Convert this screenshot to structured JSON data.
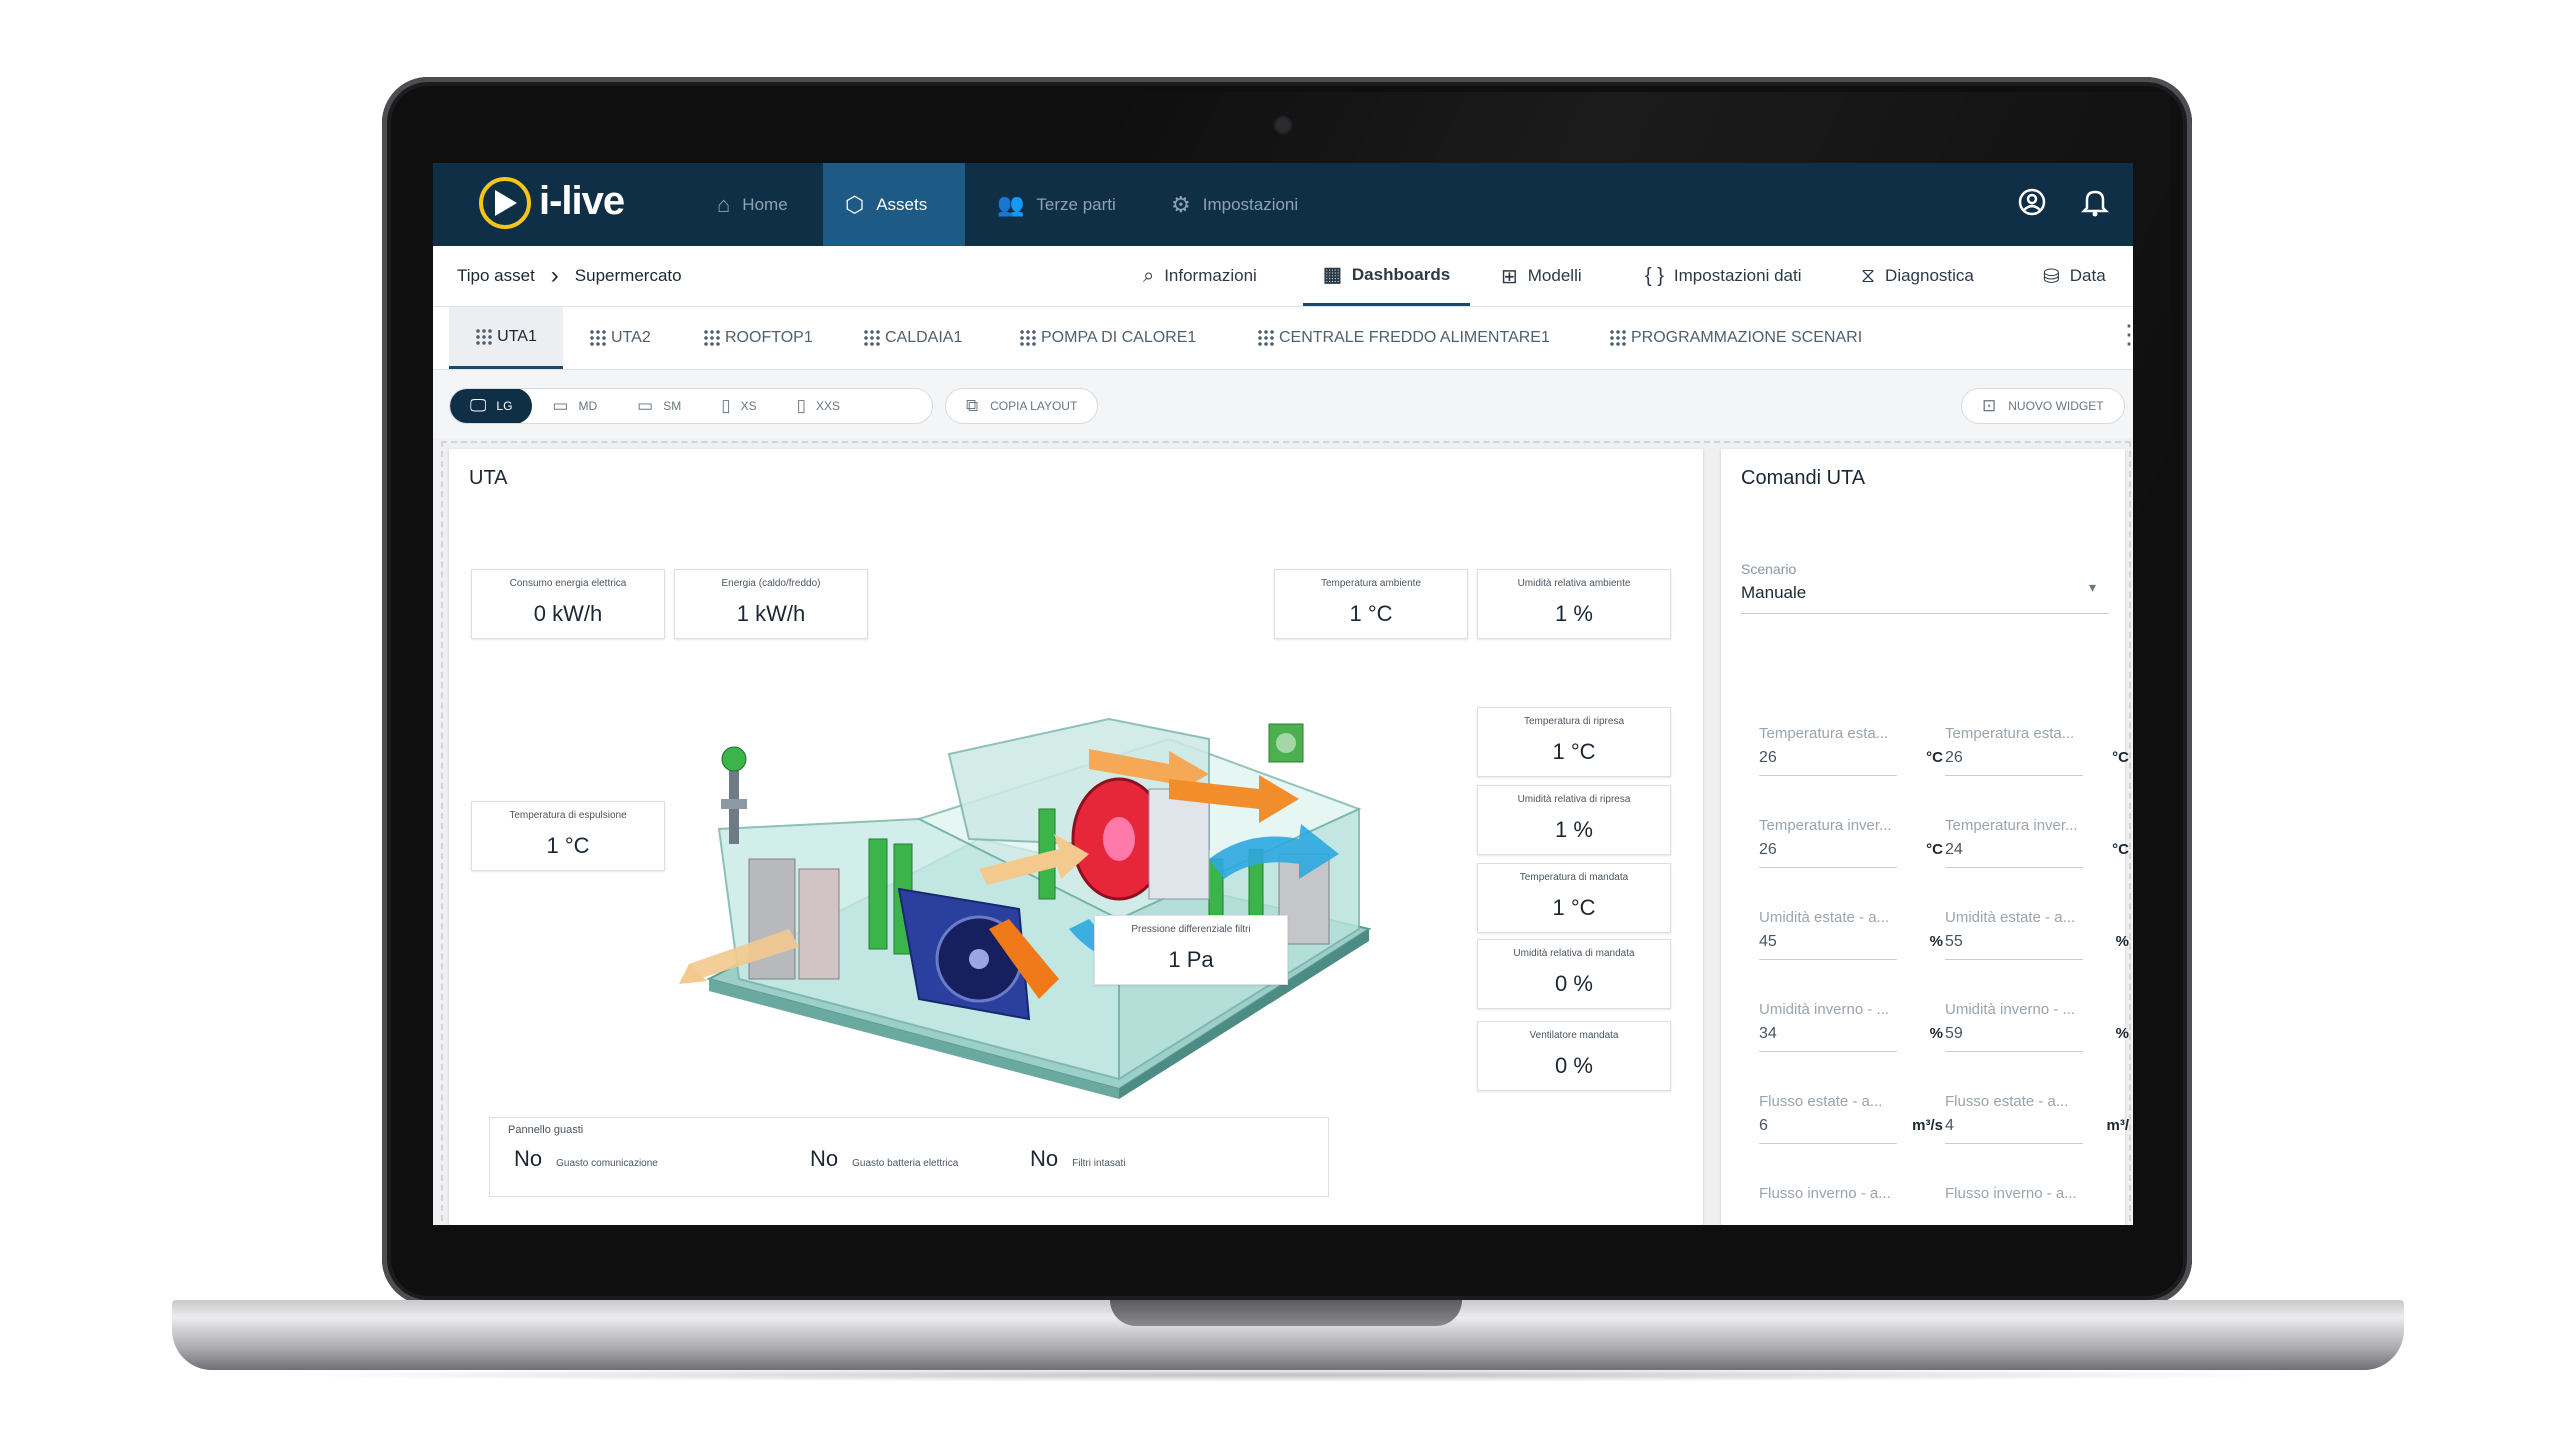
{
  "app": {
    "logo_text": "i-live"
  },
  "nav": {
    "items": [
      {
        "label": "Home",
        "icon": "home-icon"
      },
      {
        "label": "Assets",
        "icon": "cube-icon",
        "active": true
      },
      {
        "label": "Terze parti",
        "icon": "people-icon"
      },
      {
        "label": "Impostazioni",
        "icon": "gear-icon"
      }
    ]
  },
  "breadcrumb": {
    "root": "Tipo asset",
    "current": "Supermercato"
  },
  "subtabs": [
    {
      "label": "Informazioni",
      "icon": "info-search-icon"
    },
    {
      "label": "Dashboards",
      "icon": "dashboard-icon",
      "active": true
    },
    {
      "label": "Modelli",
      "icon": "models-icon"
    },
    {
      "label": "Impostazioni dati",
      "icon": "braces-icon"
    },
    {
      "label": "Diagnostica",
      "icon": "diagnostics-icon"
    },
    {
      "label": "Data",
      "icon": "database-icon"
    }
  ],
  "asset_tabs": [
    "UTA1",
    "UTA2",
    "ROOFTOP1",
    "CALDAIA1",
    "POMPA DI CALORE1",
    "CENTRALE FREDDO ALIMENTARE1",
    "PROGRAMMAZIONE SCENARI"
  ],
  "toolbar": {
    "sizes": [
      "LG",
      "MD",
      "SM",
      "XS",
      "XXS"
    ],
    "copy_layout": "COPIA LAYOUT",
    "new_widget": "NUOVO WIDGET"
  },
  "uta": {
    "title": "UTA",
    "readouts": {
      "consumo": {
        "label": "Consumo energia elettrica",
        "value": "0 kW/h"
      },
      "energia": {
        "label": "Energia (caldo/freddo)",
        "value": "1 kW/h"
      },
      "temp_amb": {
        "label": "Temperatura ambiente",
        "value": "1 °C"
      },
      "umid_amb": {
        "label": "Umidità relativa ambiente",
        "value": "1 %"
      },
      "temp_ripresa": {
        "label": "Temperatura di ripresa",
        "value": "1 °C"
      },
      "umid_ripresa": {
        "label": "Umidità relativa di ripresa",
        "value": "1 %"
      },
      "temp_mandata": {
        "label": "Temperatura di mandata",
        "value": "1 °C"
      },
      "umid_mandata": {
        "label": "Umidità relativa di mandata",
        "value": "0 %"
      },
      "ventilatore": {
        "label": "Ventilatore mandata",
        "value": "0 %"
      },
      "temp_espulsione": {
        "label": "Temperatura di espulsione",
        "value": "1 °C"
      },
      "pressione": {
        "label": "Pressione differenziale filtri",
        "value": "1 Pa"
      }
    },
    "faults": {
      "title": "Pannello guasti",
      "items": [
        {
          "value": "No",
          "label": "Guasto comunicazione"
        },
        {
          "value": "No",
          "label": "Guasto batteria elettrica"
        },
        {
          "value": "No",
          "label": "Filtri intasati"
        }
      ]
    }
  },
  "comandi": {
    "title": "Comandi UTA",
    "scenario_label": "Scenario",
    "scenario_value": "Manuale",
    "fields": [
      {
        "label": "Temperatura esta...",
        "value": "26",
        "unit": "°C"
      },
      {
        "label": "Temperatura esta...",
        "value": "26",
        "unit": "°C"
      },
      {
        "label": "Temperatura inver...",
        "value": "26",
        "unit": "°C"
      },
      {
        "label": "Temperatura inver...",
        "value": "24",
        "unit": "°C"
      },
      {
        "label": "Umidità estate - a...",
        "value": "45",
        "unit": "%"
      },
      {
        "label": "Umidità estate - a...",
        "value": "55",
        "unit": "%"
      },
      {
        "label": "Umidità inverno - ...",
        "value": "34",
        "unit": "%"
      },
      {
        "label": "Umidità inverno - ...",
        "value": "59",
        "unit": "%"
      },
      {
        "label": "Flusso estate - a...",
        "value": "6",
        "unit": "m³/s"
      },
      {
        "label": "Flusso estate - a...",
        "value": "4",
        "unit": "m³/"
      },
      {
        "label": "Flusso inverno - a...",
        "value": "",
        "unit": ""
      },
      {
        "label": "Flusso inverno - a...",
        "value": "",
        "unit": ""
      }
    ]
  }
}
